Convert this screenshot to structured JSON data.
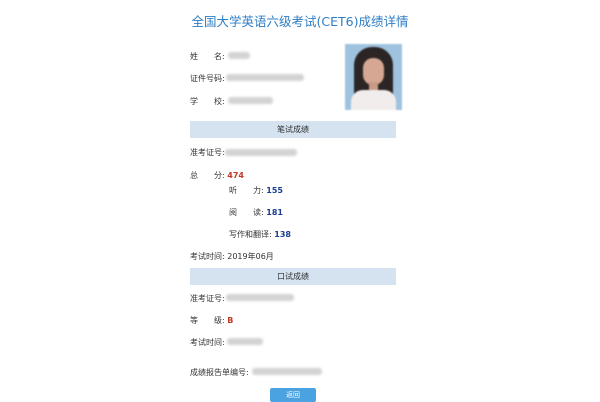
{
  "page": {
    "title": "全国大学英语六级考试(CET6)成绩详情"
  },
  "candidate": {
    "name_label": "姓　　名:",
    "id_label": "证件号码:",
    "school_label": "学　　校:"
  },
  "written": {
    "section_title": "笔试成绩",
    "ticket_label": "准考证号:",
    "total_label": "总　　分:",
    "total_value": "474",
    "listening_label": "听　　力:",
    "listening_value": "155",
    "reading_label": "阅　　读:",
    "reading_value": "181",
    "writing_label": "写作和翻译:",
    "writing_value": "138",
    "exam_time_label": "考试时间:",
    "exam_time_value": "2019年06月"
  },
  "oral": {
    "section_title": "口试成绩",
    "ticket_label": "准考证号:",
    "grade_label": "等　　级:",
    "grade_value": "B",
    "exam_time_label": "考试时间:"
  },
  "report": {
    "number_label": "成绩报告单编号:"
  },
  "actions": {
    "back_label": "返回"
  },
  "colors": {
    "title": "#2e7ec4",
    "section_bg": "#d5e3f1",
    "total_score": "#c0392b",
    "sub_scores": "#1a3f8f",
    "button": "#4aa3e0"
  }
}
